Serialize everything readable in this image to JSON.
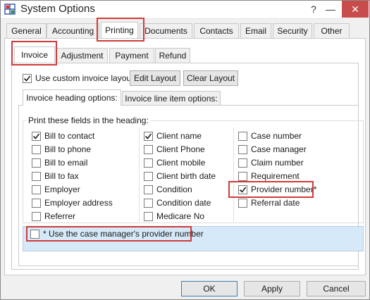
{
  "window": {
    "title": "System Options",
    "icons": {
      "app": "system-options-grid-icon",
      "help": "help-icon",
      "minimize": "minimize-icon",
      "close": "close-icon"
    },
    "help_label": "?",
    "minimize_label": "—",
    "close_label": "✕"
  },
  "main_tabs": [
    {
      "label": "General",
      "active": false
    },
    {
      "label": "Accounting",
      "active": false
    },
    {
      "label": "Printing",
      "active": true,
      "highlighted": true
    },
    {
      "label": "Documents",
      "active": false
    },
    {
      "label": "Contacts",
      "active": false
    },
    {
      "label": "Email",
      "active": false
    },
    {
      "label": "Security",
      "active": false
    },
    {
      "label": "Other",
      "active": false
    }
  ],
  "print_tabs": [
    {
      "label": "Invoice",
      "active": true,
      "highlighted": true
    },
    {
      "label": "Adjustment",
      "active": false
    },
    {
      "label": "Payment",
      "active": false
    },
    {
      "label": "Refund",
      "active": false
    }
  ],
  "custom_layout": {
    "label": "Use custom invoice layout:",
    "checked": true,
    "edit_button": "Edit Layout",
    "clear_button": "Clear Layout"
  },
  "heading_tabs": [
    {
      "label": "Invoice heading options:",
      "active": true
    },
    {
      "label": "Invoice line item options:",
      "active": false
    }
  ],
  "fields_group": {
    "title": "Print these fields in the heading:",
    "columns": [
      [
        {
          "label": "Bill to contact",
          "checked": true
        },
        {
          "label": "Bill to phone",
          "checked": false
        },
        {
          "label": "Bill to email",
          "checked": false
        },
        {
          "label": "Bill to fax",
          "checked": false
        },
        {
          "label": "Employer",
          "checked": false
        },
        {
          "label": "Employer address",
          "checked": false
        },
        {
          "label": "Referrer",
          "checked": false
        }
      ],
      [
        {
          "label": "Client name",
          "checked": true
        },
        {
          "label": "Client Phone",
          "checked": false
        },
        {
          "label": "Client mobile",
          "checked": false
        },
        {
          "label": "Client birth date",
          "checked": false
        },
        {
          "label": "Condition",
          "checked": false
        },
        {
          "label": "Condition date",
          "checked": false
        },
        {
          "label": "Medicare No",
          "checked": false
        }
      ],
      [
        {
          "label": "Case number",
          "checked": false
        },
        {
          "label": "Case manager",
          "checked": false
        },
        {
          "label": "Claim number",
          "checked": false
        },
        {
          "label": "Requirement",
          "checked": false
        },
        {
          "label": "Provider number*",
          "checked": true,
          "highlighted": true
        },
        {
          "label": "Referral date",
          "checked": false
        }
      ]
    ]
  },
  "provider_option": {
    "label": "* Use the case manager's provider number",
    "checked": false,
    "highlighted": true,
    "background": "#d6e9f8"
  },
  "footer": {
    "ok": "OK",
    "apply": "Apply",
    "cancel": "Cancel"
  },
  "colors": {
    "highlight_box": "#d03a3a",
    "info_strip": "#d6e9f8",
    "close_button": "#c94c4c"
  }
}
